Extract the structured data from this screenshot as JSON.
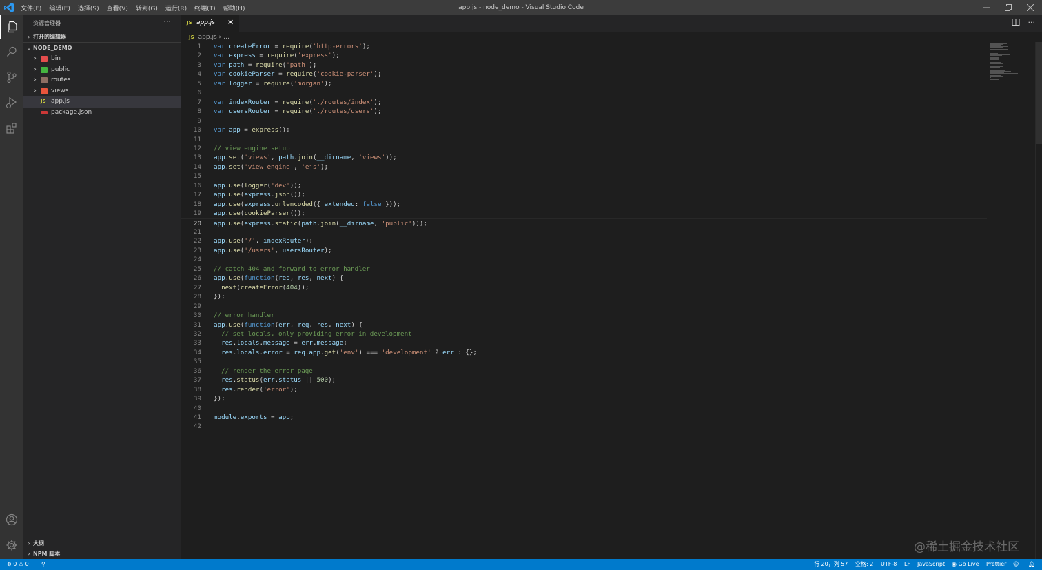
{
  "titlebar": {
    "menu": [
      "文件(F)",
      "编辑(E)",
      "选择(S)",
      "查看(V)",
      "转到(G)",
      "运行(R)",
      "终端(T)",
      "帮助(H)"
    ],
    "title": "app.js - node_demo - Visual Studio Code"
  },
  "sidebar": {
    "title": "资源管理器",
    "more": "···",
    "open_editors": "打开的编辑器",
    "folder": "NODE_DEMO",
    "items": [
      {
        "label": "bin",
        "type": "folder"
      },
      {
        "label": "public",
        "type": "folder"
      },
      {
        "label": "routes",
        "type": "folder"
      },
      {
        "label": "views",
        "type": "folder"
      },
      {
        "label": "app.js",
        "type": "file",
        "selected": true
      },
      {
        "label": "package.json",
        "type": "file"
      }
    ],
    "outline": "大纲",
    "npm_scripts": "NPM 脚本"
  },
  "tab": {
    "label": "app.js",
    "lang_badge": "JS"
  },
  "breadcrumb": {
    "file": "app.js",
    "rest": "…"
  },
  "editor": {
    "current_line": 20,
    "lines": [
      "var createError = require('http-errors');",
      "var express = require('express');",
      "var path = require('path');",
      "var cookieParser = require('cookie-parser');",
      "var logger = require('morgan');",
      "",
      "var indexRouter = require('./routes/index');",
      "var usersRouter = require('./routes/users');",
      "",
      "var app = express();",
      "",
      "// view engine setup",
      "app.set('views', path.join(__dirname, 'views'));",
      "app.set('view engine', 'ejs');",
      "",
      "app.use(logger('dev'));",
      "app.use(express.json());",
      "app.use(express.urlencoded({ extended: false }));",
      "app.use(cookieParser());",
      "app.use(express.static(path.join(__dirname, 'public')));",
      "",
      "app.use('/', indexRouter);",
      "app.use('/users', usersRouter);",
      "",
      "// catch 404 and forward to error handler",
      "app.use(function(req, res, next) {",
      "  next(createError(404));",
      "});",
      "",
      "// error handler",
      "app.use(function(err, req, res, next) {",
      "  // set locals, only providing error in development",
      "  res.locals.message = err.message;",
      "  res.locals.error = req.app.get('env') === 'development' ? err : {};",
      "",
      "  // render the error page",
      "  res.status(err.status || 500);",
      "  res.render('error');",
      "});",
      "",
      "module.exports = app;",
      ""
    ]
  },
  "statusbar": {
    "errors": "0",
    "warnings": "0",
    "position": "行 20，列 57",
    "spaces": "空格: 2",
    "encoding": "UTF-8",
    "eol": "LF",
    "language": "JavaScript",
    "golive": "Go Live",
    "prettier": "Prettier"
  },
  "watermark": "@稀土掘金技术社区",
  "colors": {
    "keyword": "#569cd6",
    "string": "#ce9178",
    "comment": "#6a9955",
    "variable": "#9cdcfe",
    "function": "#dcdcaa",
    "number": "#b5cea8",
    "statusbar": "#007acc"
  }
}
